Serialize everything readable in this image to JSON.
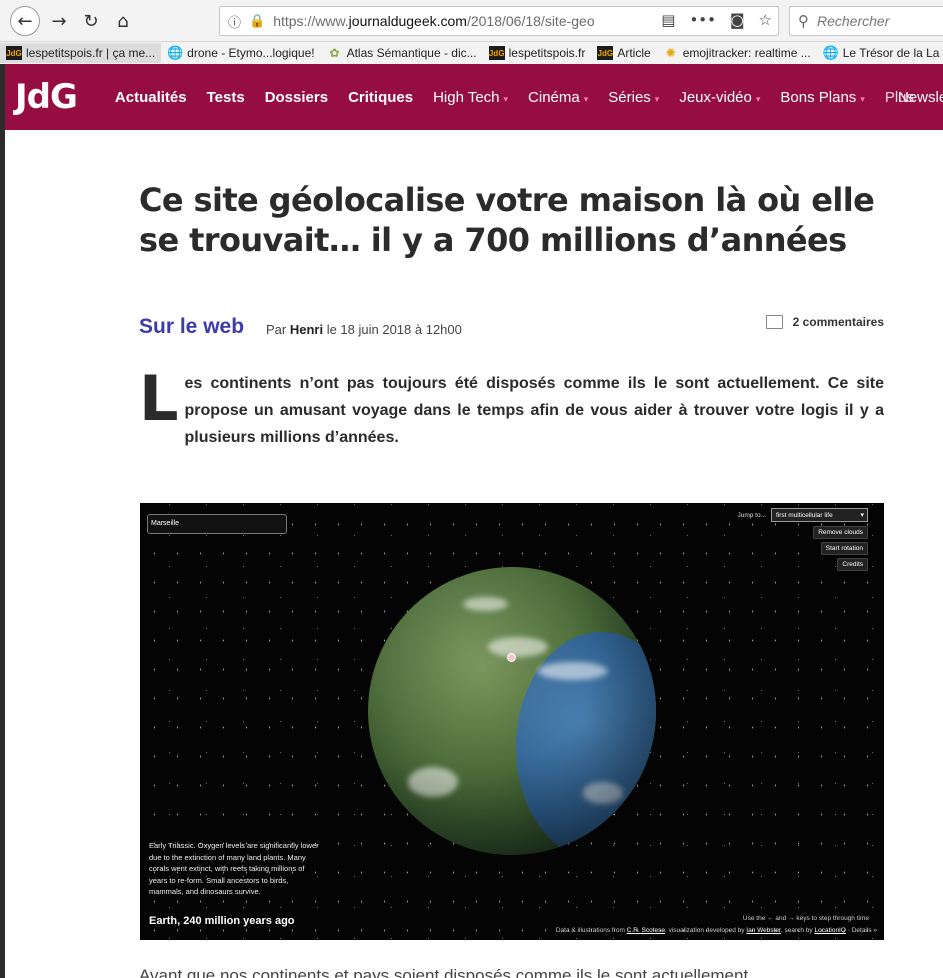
{
  "browser": {
    "url_prefix": "https://www.",
    "url_host": "journaldugeek.com",
    "url_path": "/2018/06/18/site-geo",
    "search_placeholder": "Rechercher",
    "bookmarks": [
      {
        "label": "lespetitspois.fr | ça me...",
        "icon": "jdg-favicon"
      },
      {
        "label": "drone - Etymo...logique!",
        "icon": "globe-icon"
      },
      {
        "label": "Atlas Sémantique - dic...",
        "icon": "atlas-icon"
      },
      {
        "label": "lespetitspois.fr",
        "icon": "jdg-favicon"
      },
      {
        "label": "Article",
        "icon": "jdg-favicon"
      },
      {
        "label": "emojitracker: realtime ...",
        "icon": "emoji-icon"
      },
      {
        "label": "Le Trésor de la La",
        "icon": "globe-icon"
      }
    ]
  },
  "site": {
    "logo": "JdG",
    "menu": [
      {
        "label": "Actualités",
        "style": "bold"
      },
      {
        "label": "Tests",
        "style": "bold"
      },
      {
        "label": "Dossiers",
        "style": "bold"
      },
      {
        "label": "Critiques",
        "style": "bold"
      },
      {
        "label": "High Tech",
        "style": "dropdown"
      },
      {
        "label": "Cinéma",
        "style": "dropdown"
      },
      {
        "label": "Séries",
        "style": "dropdown"
      },
      {
        "label": "Jeux-vidéo",
        "style": "dropdown"
      },
      {
        "label": "Bons Plans",
        "style": "dropdown"
      },
      {
        "label": "Plus",
        "style": "light"
      }
    ],
    "newsletter": "Newsle"
  },
  "article": {
    "title": "Ce site géolocalise votre maison là où elle se trouvait… il y a 700 millions d’années",
    "section": "Sur le web",
    "byline_prefix": "Par ",
    "author": "Henri",
    "date": " le 18 juin 2018 à 12h00",
    "comments": "2 commentaires",
    "dropcap": "L",
    "lead": "es continents n’ont pas toujours été disposés comme ils le sont actuellement. Ce site propose un amusant voyage dans le temps afin de vous aider à trouver votre logis il y a plusieurs millions d’années.",
    "body_start": "Avant que nos continents et pays soient disposés comme ils le sont actuellement,"
  },
  "hero": {
    "location_value": "Marseille",
    "jump_label": "Jump to...",
    "jump_selected": "first multicellular life",
    "buttons": [
      "Remove clouds",
      "Start rotation",
      "Credits"
    ],
    "description": "Early Triassic. Oxygen levels are significantly lower due to the extinction of many land plants. Many corals went extinct, with reefs taking millions of years to re-form. Small ancestors to birds, mammals, and dinosaurs survive.",
    "era_label": "Earth, 240 million years ago",
    "keys_hint": "Use the ← and → keys to step through time",
    "credits_prefix": "Data & illustrations from ",
    "credits_scotese": "C.R. Scotese",
    "credits_mid": ", visualization developed by ",
    "credits_webster": "Ian Webster",
    "credits_search": ", search by ",
    "credits_liq": "LocationIQ",
    "credits_details": " · Details »"
  }
}
